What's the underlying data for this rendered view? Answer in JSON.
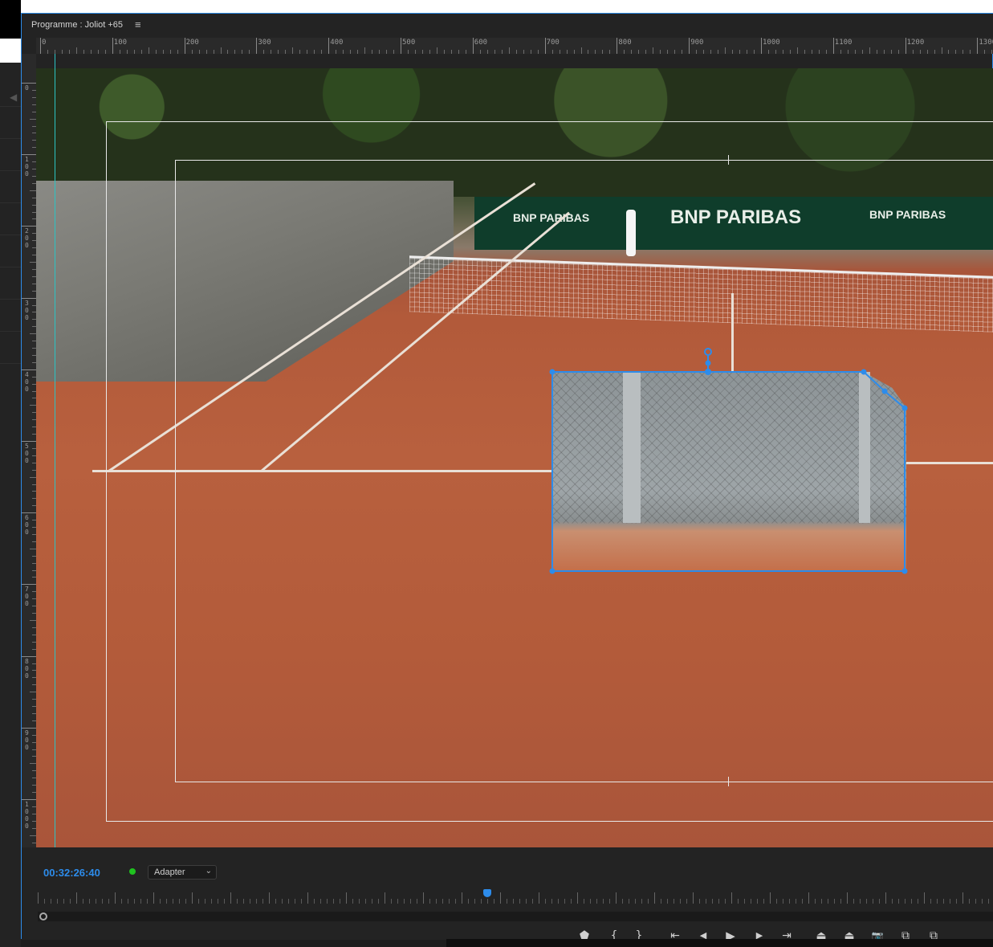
{
  "panel": {
    "title": "Programme : Joliot +65",
    "menu_icon": "≡"
  },
  "ruler": {
    "horizontal_labels": [
      "0",
      "100",
      "200",
      "300",
      "400",
      "500",
      "600",
      "700",
      "800",
      "900",
      "1000",
      "1100",
      "1200",
      "1300"
    ],
    "vertical_labels": [
      "0",
      "100",
      "200",
      "300",
      "400",
      "500",
      "600",
      "700",
      "800",
      "900",
      "1000"
    ]
  },
  "frame": {
    "banner_text_1": "BNP PARIBAS",
    "banner_text_2": "BNP  PARIBAS",
    "banner_text_3": "BNP PARIBAS"
  },
  "controls": {
    "timecode": "00:32:26:40",
    "fit_value": "Adapter",
    "fit_chevron": "⌄",
    "playhead_fraction": 0.47
  },
  "buttons": [
    {
      "name": "add-marker-icon",
      "glyph": "⬟"
    },
    {
      "name": "mark-in-icon",
      "glyph": "{"
    },
    {
      "name": "mark-out-icon",
      "glyph": "}"
    },
    {
      "name": "go-to-in-icon",
      "glyph": "⇤"
    },
    {
      "name": "step-back-icon",
      "glyph": "◀"
    },
    {
      "name": "play-icon",
      "glyph": "▶"
    },
    {
      "name": "step-forward-icon",
      "glyph": "▶"
    },
    {
      "name": "go-to-out-icon",
      "glyph": "⇥"
    },
    {
      "name": "lift-icon",
      "glyph": "⏏"
    },
    {
      "name": "extract-icon",
      "glyph": "⏏"
    },
    {
      "name": "export-frame-icon",
      "glyph": "📷"
    },
    {
      "name": "comparison-view-icon",
      "glyph": "⧉"
    },
    {
      "name": "toggle-proxies-icon",
      "glyph": "⧉"
    }
  ],
  "colors": {
    "accent": "#2d8ceb",
    "guide_line": "#2bc4c4",
    "status_green": "#1fc21f"
  }
}
